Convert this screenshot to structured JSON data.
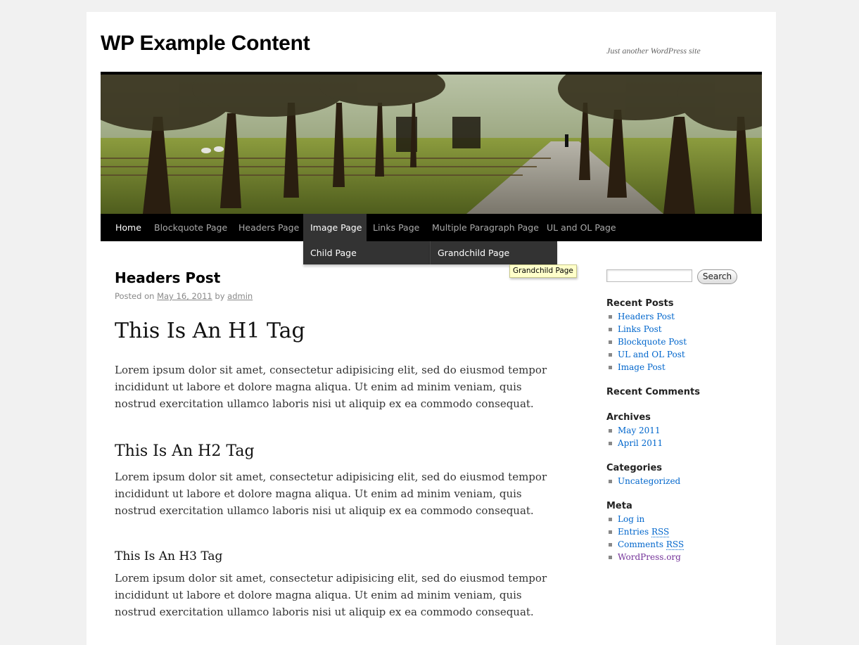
{
  "site": {
    "title": "WP Example Content",
    "description": "Just another WordPress site"
  },
  "nav": {
    "items": [
      {
        "label": "Home"
      },
      {
        "label": "Blockquote Page"
      },
      {
        "label": "Headers Page"
      },
      {
        "label": "Image Page"
      },
      {
        "label": "Links Page"
      },
      {
        "label": "Multiple Paragraph Page"
      },
      {
        "label": "UL and OL Page"
      }
    ],
    "current": "Home",
    "hovered": "Image Page",
    "submenu": {
      "label": "Child Page"
    },
    "subsubmenu": {
      "label": "Grandchild Page"
    },
    "tooltip": "Grandchild Page"
  },
  "post": {
    "title": "Headers Post",
    "meta_prefix": "Posted on",
    "date": "May 16, 2011",
    "by": "by",
    "author": "admin",
    "h1": "This Is An H1 Tag",
    "h2": "This Is An H2 Tag",
    "h3": "This Is An H3 Tag",
    "paragraph_1": "Lorem ipsum dolor sit amet, consectetur adipisicing elit, sed do eiusmod tempor incididunt ut labore et dolore magna aliqua. Ut enim ad minim veniam, quis nostrud exercitation ullamco laboris nisi ut aliquip ex ea commodo consequat.",
    "paragraph_2": "Lorem ipsum dolor sit amet, consectetur adipisicing elit, sed do eiusmod tempor incididunt ut labore et dolore magna aliqua. Ut enim ad minim veniam, quis nostrud exercitation ullamco laboris nisi ut aliquip ex ea commodo consequat.",
    "paragraph_3": "Lorem ipsum dolor sit amet, consectetur adipisicing elit, sed do eiusmod tempor incididunt ut labore et dolore magna aliqua. Ut enim ad minim veniam, quis nostrud exercitation ullamco laboris nisi ut aliquip ex ea commodo consequat."
  },
  "sidebar": {
    "search": {
      "value": "",
      "button": "Search"
    },
    "recent_posts": {
      "title": "Recent Posts",
      "items": [
        "Headers Post",
        "Links Post",
        "Blockquote Post",
        "UL and OL Post",
        "Image Post"
      ]
    },
    "recent_comments": {
      "title": "Recent Comments"
    },
    "archives": {
      "title": "Archives",
      "items": [
        "May 2011",
        "April 2011"
      ]
    },
    "categories": {
      "title": "Categories",
      "items": [
        "Uncategorized"
      ]
    },
    "meta": {
      "title": "Meta",
      "login": "Log in",
      "entries_prefix": "Entries",
      "entries_abbr": "RSS",
      "comments_prefix": "Comments",
      "comments_abbr": "RSS",
      "wordpress": "WordPress.org"
    }
  },
  "colors": {
    "link": "#0066cc",
    "visited_link": "#743399",
    "nav_bg": "#000000",
    "tooltip_bg": "#ffffca"
  }
}
